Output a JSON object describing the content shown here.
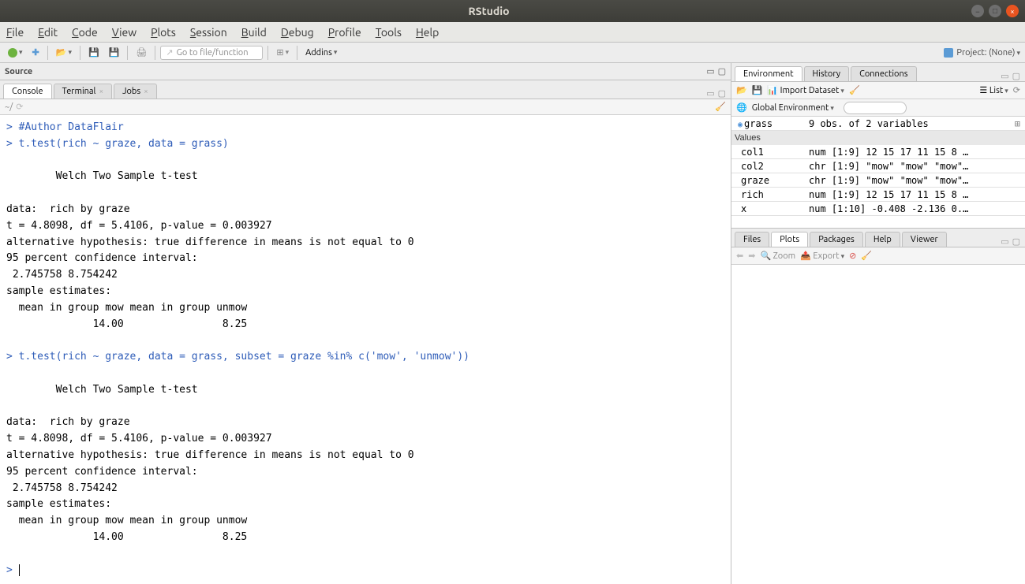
{
  "title": "RStudio",
  "menubar": [
    "File",
    "Edit",
    "Code",
    "View",
    "Plots",
    "Session",
    "Build",
    "Debug",
    "Profile",
    "Tools",
    "Help"
  ],
  "toolbar": {
    "goto_placeholder": "Go to file/function",
    "addins": "Addins",
    "project": "Project: (None)"
  },
  "source": {
    "header": "Source"
  },
  "left_tabs": [
    {
      "label": "Console",
      "active": true,
      "closable": false
    },
    {
      "label": "Terminal",
      "active": false,
      "closable": true
    },
    {
      "label": "Jobs",
      "active": false,
      "closable": true
    }
  ],
  "console_path": "~/",
  "console_lines": [
    {
      "t": "in",
      "text": "#Author DataFlair"
    },
    {
      "t": "in",
      "text": "t.test(rich ~ graze, data = grass)"
    },
    {
      "t": "out",
      "text": ""
    },
    {
      "t": "out",
      "text": "        Welch Two Sample t-test"
    },
    {
      "t": "out",
      "text": ""
    },
    {
      "t": "out",
      "text": "data:  rich by graze"
    },
    {
      "t": "out",
      "text": "t = 4.8098, df = 5.4106, p-value = 0.003927"
    },
    {
      "t": "out",
      "text": "alternative hypothesis: true difference in means is not equal to 0"
    },
    {
      "t": "out",
      "text": "95 percent confidence interval:"
    },
    {
      "t": "out",
      "text": " 2.745758 8.754242"
    },
    {
      "t": "out",
      "text": "sample estimates:"
    },
    {
      "t": "out",
      "text": "  mean in group mow mean in group unmow "
    },
    {
      "t": "out",
      "text": "              14.00                8.25 "
    },
    {
      "t": "out",
      "text": ""
    },
    {
      "t": "in",
      "text": "t.test(rich ~ graze, data = grass, subset = graze %in% c('mow', 'unmow'))"
    },
    {
      "t": "out",
      "text": ""
    },
    {
      "t": "out",
      "text": "        Welch Two Sample t-test"
    },
    {
      "t": "out",
      "text": ""
    },
    {
      "t": "out",
      "text": "data:  rich by graze"
    },
    {
      "t": "out",
      "text": "t = 4.8098, df = 5.4106, p-value = 0.003927"
    },
    {
      "t": "out",
      "text": "alternative hypothesis: true difference in means is not equal to 0"
    },
    {
      "t": "out",
      "text": "95 percent confidence interval:"
    },
    {
      "t": "out",
      "text": " 2.745758 8.754242"
    },
    {
      "t": "out",
      "text": "sample estimates:"
    },
    {
      "t": "out",
      "text": "  mean in group mow mean in group unmow "
    },
    {
      "t": "out",
      "text": "              14.00                8.25 "
    },
    {
      "t": "out",
      "text": ""
    },
    {
      "t": "prompt",
      "text": ""
    }
  ],
  "env_tabs": [
    {
      "label": "Environment",
      "active": true
    },
    {
      "label": "History",
      "active": false
    },
    {
      "label": "Connections",
      "active": false
    }
  ],
  "env_toolbar": {
    "import": "Import Dataset",
    "list": "List",
    "scope": "Global Environment"
  },
  "env_data": {
    "expandable": {
      "name": "grass",
      "desc": "9 obs. of 2 variables"
    },
    "values_header": "Values",
    "values": [
      {
        "name": "col1",
        "desc": "num [1:9] 12 15 17 11 15 8 …"
      },
      {
        "name": "col2",
        "desc": "chr [1:9] \"mow\" \"mow\" \"mow\"…"
      },
      {
        "name": "graze",
        "desc": "chr [1:9] \"mow\" \"mow\" \"mow\"…"
      },
      {
        "name": "rich",
        "desc": "num [1:9] 12 15 17 11 15 8 …"
      },
      {
        "name": "x",
        "desc": "num [1:10] -0.408 -2.136 0.…"
      }
    ]
  },
  "plot_tabs": [
    {
      "label": "Files",
      "active": false
    },
    {
      "label": "Plots",
      "active": true
    },
    {
      "label": "Packages",
      "active": false
    },
    {
      "label": "Help",
      "active": false
    },
    {
      "label": "Viewer",
      "active": false
    }
  ],
  "plot_toolbar": {
    "zoom": "Zoom",
    "export": "Export"
  }
}
